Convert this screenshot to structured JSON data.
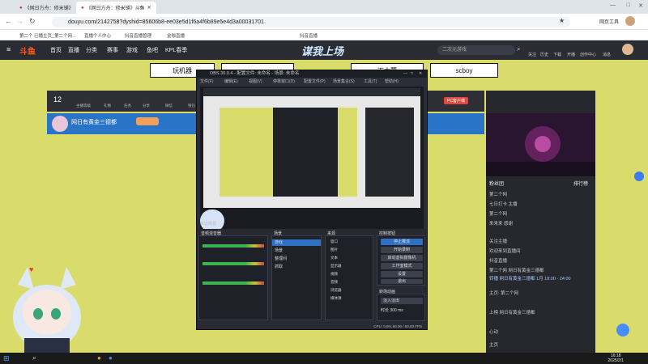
{
  "browser": {
    "tabs": [
      {
        "label": "《网日方舟：修米铺》"
      },
      {
        "label": "《网日方舟：修米铺》斗鱼"
      }
    ],
    "url": "douyu.com/2142758?dyshid=85606b8-ee03e5d1f6a4f6b89e5e4d3a00031701",
    "profile_label": "网页工具",
    "bookmarks": [
      "第二个 已播主页_第二个网...",
      "直播个人中心",
      "抖音直播管理",
      "金咖直播",
      "抖音直播"
    ]
  },
  "douyu": {
    "logo": "斗鱼",
    "nav": [
      "首页",
      "直播",
      "分类",
      "赛事",
      "游戏",
      "鱼吧",
      "KPL春季"
    ],
    "header_right": [
      "关注",
      "历史",
      "下载",
      "开播",
      "创作中心",
      "消息"
    ],
    "search_placeholder": "二次元游戏",
    "banner_center": "谋我上场",
    "banner_items": [
      "玩机器",
      "",
      "下大蒙",
      "scboy"
    ],
    "level": "12",
    "room_tools": [
      "主播等级",
      "礼物",
      "任务",
      "分享",
      "微信",
      "钱包"
    ],
    "room_right": [
      "PC客户端"
    ],
    "streamer_name": "网日有黄金三德都",
    "chat_header": [
      "粉丝团",
      "排行榜"
    ],
    "chat_lines": [
      "第二个网",
      "七日打卡  主播",
      "第二个网",
      "来来来  感谢",
      "关注主播",
      "欢迎来到直播间",
      "抖音直播",
      "第二个网 网日有黄金三德都",
      "主页: 第二个网",
      "上榜  网日有黄金三德都",
      "心动",
      "主页"
    ],
    "chat_notice": "转播  网日有黄金三德都  1月  18:00 - 24:00"
  },
  "obs": {
    "title": "OBS 30.0.4 - 配置文件: 未命名 - 场景: 未命名",
    "menu": [
      "文件(F)",
      "编辑(E)",
      "视图(V)",
      "停靠窗口(D)",
      "配置文件(P)",
      "场景集合(S)",
      "工具(T)",
      "帮助(H)"
    ],
    "preview_label": "未选择源",
    "panels": {
      "audio": "音频混音器",
      "scenes": "场景",
      "sources": "来源",
      "controls": "控制按钮",
      "transitions": "转场动画"
    },
    "scenes": [
      "游戏",
      "场景",
      "整理间",
      "抓取"
    ],
    "sources": [
      "窗口",
      "图片",
      "文本",
      "显示器",
      "视频",
      "音频",
      "浏览器",
      "媒体源"
    ],
    "controls": [
      "停止推流",
      "开始录制",
      "启动虚拟摄像机",
      "工作室模式",
      "设置",
      "退出"
    ],
    "transition_type": "淡入淡出",
    "transition_duration": "时长  300 ms",
    "status": "CPU: 0.8%   60.00 / 60.00 FPS"
  },
  "taskbar": {
    "time": "16:18",
    "date": "2025/2/1"
  }
}
